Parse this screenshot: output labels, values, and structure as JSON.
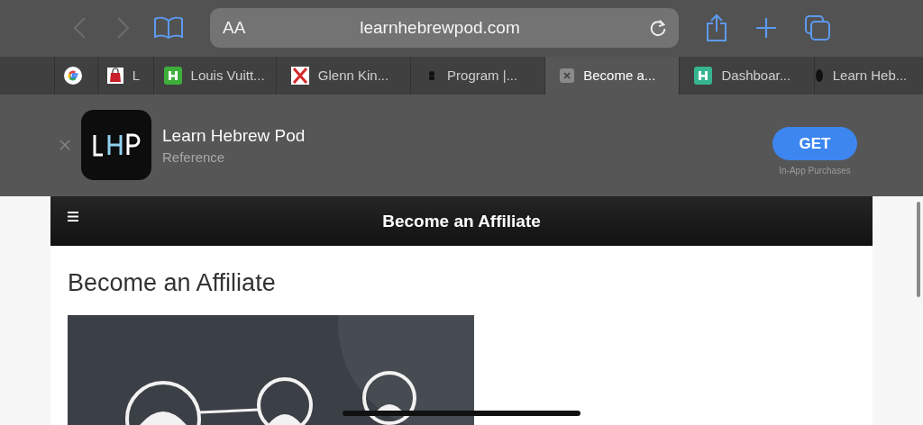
{
  "toolbar": {
    "back_disabled": true,
    "forward_disabled": true,
    "text_size": "AA",
    "address": "learnhebrewpod.com"
  },
  "tabs": [
    {
      "kind": "google",
      "selected": false
    },
    {
      "kind": "bag",
      "label": "L",
      "selected": false
    },
    {
      "kind": "square",
      "color": "#3dae3a",
      "label": "Louis Vuitt...",
      "selected": false
    },
    {
      "kind": "cross",
      "color": "#d42a2a",
      "label": "Glenn Kin...",
      "selected": false
    },
    {
      "kind": "glyph",
      "label": "Program |...",
      "selected": false
    },
    {
      "kind": "close",
      "label": "Become a...",
      "selected": true
    },
    {
      "kind": "square",
      "color": "#35b58f",
      "label": "Dashboar...",
      "selected": false
    },
    {
      "kind": "dot",
      "label": "Learn Heb...",
      "selected": false
    }
  ],
  "app_banner": {
    "app_name": "Learn Hebrew Pod",
    "category": "Reference",
    "button": "GET",
    "note": "In-App Purchases"
  },
  "page": {
    "header_title": "Become an Affiliate",
    "heading": "Become an Affiliate"
  }
}
